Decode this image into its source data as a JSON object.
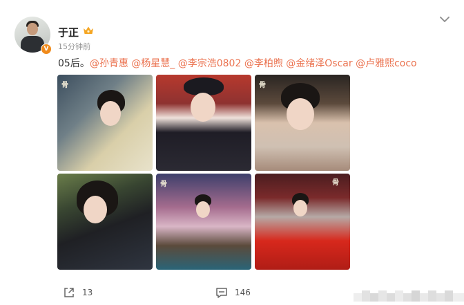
{
  "post": {
    "author": "于正",
    "timestamp": "15分钟前",
    "text_prefix": "05后。",
    "mentions": [
      "@孙青惠",
      "@杨星慧_",
      "@李宗浩0802",
      "@李柏煦",
      "@金绪泽Oscar",
      "@卢雅熙coco"
    ],
    "verified_badge": "V",
    "watermark": "骨"
  },
  "photos": [
    {
      "name": "photo-1"
    },
    {
      "name": "photo-2"
    },
    {
      "name": "photo-3"
    },
    {
      "name": "photo-4"
    },
    {
      "name": "photo-5"
    },
    {
      "name": "photo-6"
    }
  ],
  "actions": {
    "share_count": "13",
    "comment_count": "146"
  },
  "icons": {
    "crown": "crown-icon",
    "chevron": "chevron-down-icon",
    "share": "share-icon",
    "comment": "comment-icon"
  },
  "colors": {
    "mention": "#eb7350",
    "badge": "#f08a1a"
  }
}
